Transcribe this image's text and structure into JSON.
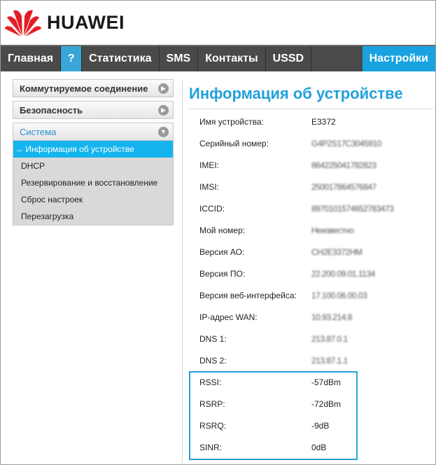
{
  "brand": "HUAWEI",
  "brand_color": "#e41e26",
  "accent_color": "#18a3e0",
  "nav": {
    "items": [
      "Главная",
      "?",
      "Статистика",
      "SMS",
      "Контакты",
      "USSD",
      "Настройки"
    ],
    "active": "Настройки"
  },
  "sidebar": {
    "groups": [
      {
        "label": "Коммутируемое соединение",
        "icon": "chevron-right-icon"
      },
      {
        "label": "Безопасность",
        "icon": "chevron-right-icon"
      },
      {
        "label": "Система",
        "icon": "chevron-down-icon",
        "open": true
      }
    ],
    "submenu": [
      {
        "label": "→ Информация об устройстве",
        "active": true
      },
      {
        "label": "DHCP"
      },
      {
        "label": "Резервирование и восстановление"
      },
      {
        "label": "Сброс настроек"
      },
      {
        "label": "Перезагрузка"
      }
    ]
  },
  "page": {
    "title": "Информация об устройстве",
    "rows": [
      {
        "key": "Имя устройства:",
        "value": "E3372"
      },
      {
        "key": "Серийный номер:",
        "value": "G4P2S17C3045910",
        "blurred": true
      },
      {
        "key": "IMEI:",
        "value": "864225041782823",
        "blurred": true
      },
      {
        "key": "IMSI:",
        "value": "250017864576847",
        "blurred": true
      },
      {
        "key": "ICCID:",
        "value": "8970101574652783473",
        "blurred": true
      },
      {
        "key": "Мой номер:",
        "value": "Неизвестно",
        "blurred": true
      },
      {
        "key": "Версия АО:",
        "value": "CH2E3372HM",
        "blurred": true
      },
      {
        "key": "Версия ПО:",
        "value": "22.200.09.01.1134",
        "blurred": true
      },
      {
        "key": "Версия веб-интерфейса:",
        "value": "17.100.06.00.03",
        "blurred": true
      },
      {
        "key": "IP-адрес WAN:",
        "value": "10.93.214.8",
        "blurred": true
      },
      {
        "key": "DNS 1:",
        "value": "213.87.0.1",
        "blurred": true
      },
      {
        "key": "DNS 2:",
        "value": "213.87.1.1",
        "blurred": true
      },
      {
        "key": "RSSI:",
        "value": "-57dBm"
      },
      {
        "key": "RSRP:",
        "value": "-72dBm"
      },
      {
        "key": "RSRQ:",
        "value": "-9dB"
      },
      {
        "key": "SINR:",
        "value": "0dB"
      }
    ]
  }
}
